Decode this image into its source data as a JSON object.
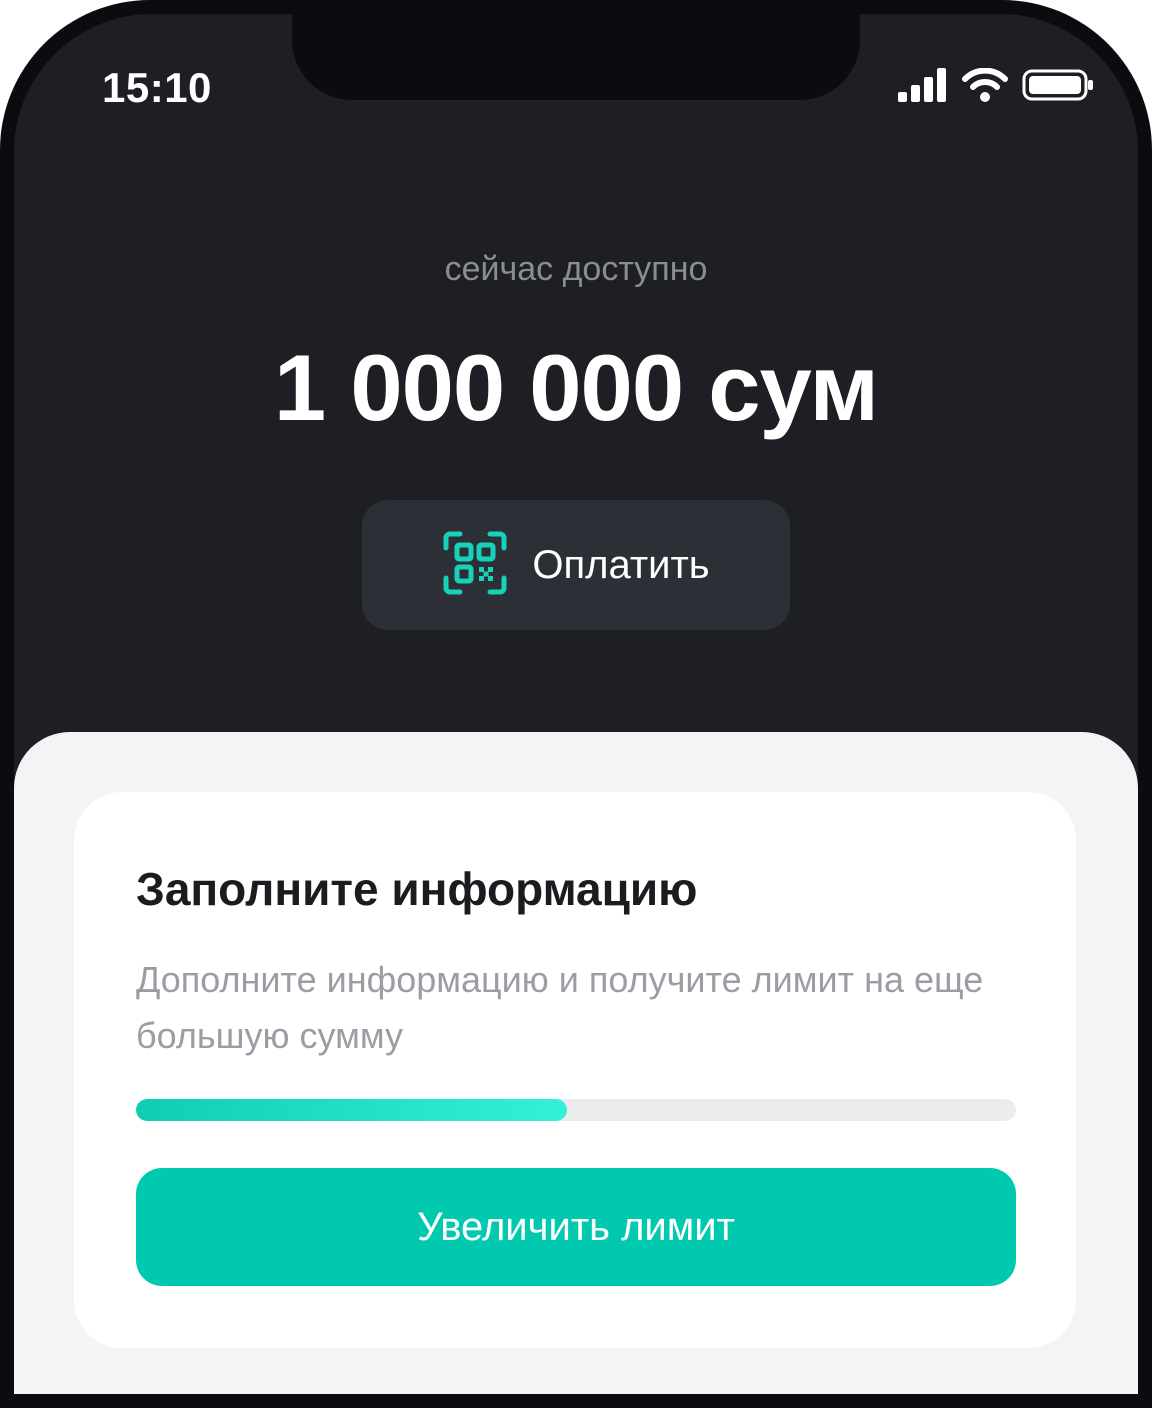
{
  "status_bar": {
    "time": "15:10",
    "icons": [
      "signal-icon",
      "wifi-icon",
      "battery-icon"
    ]
  },
  "balance": {
    "caption": "сейчас доступно",
    "amount": "1 000 000 сум"
  },
  "pay_button": {
    "icon": "qr-code-icon",
    "label": "Оплатить"
  },
  "info_card": {
    "title": "Заполните информацию",
    "description": "Дополните информацию и получите лимит на еще большую сумму",
    "progress": 0.49,
    "button_label": "Увеличить лимит"
  },
  "colors": {
    "background_dark": "#1d1f24",
    "accent": "#00c9b0",
    "qr_icon": "#17d1b8"
  }
}
